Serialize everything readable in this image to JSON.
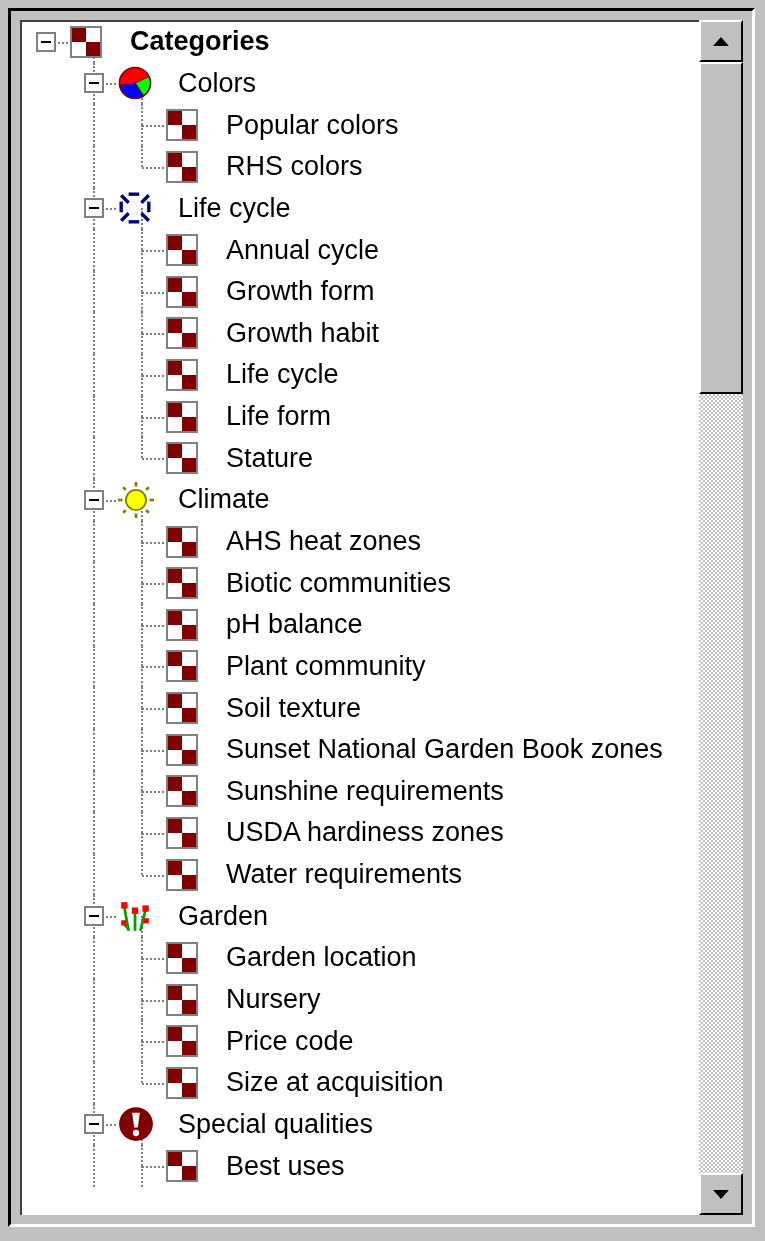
{
  "tree": {
    "nodes": [
      {
        "label": "Categories",
        "kind": "checker",
        "expanded": true,
        "children": [
          {
            "label": "Colors",
            "kind": "pie",
            "expanded": true,
            "children": [
              {
                "label": "Popular colors",
                "kind": "checker"
              },
              {
                "label": "RHS colors",
                "kind": "checker"
              }
            ]
          },
          {
            "label": "Life cycle",
            "kind": "cycle",
            "expanded": true,
            "children": [
              {
                "label": "Annual cycle",
                "kind": "checker"
              },
              {
                "label": "Growth form",
                "kind": "checker"
              },
              {
                "label": "Growth habit",
                "kind": "checker"
              },
              {
                "label": "Life cycle",
                "kind": "checker"
              },
              {
                "label": "Life form",
                "kind": "checker"
              },
              {
                "label": "Stature",
                "kind": "checker"
              }
            ]
          },
          {
            "label": "Climate",
            "kind": "sun",
            "expanded": true,
            "children": [
              {
                "label": "AHS heat zones",
                "kind": "checker"
              },
              {
                "label": "Biotic communities",
                "kind": "checker"
              },
              {
                "label": "pH balance",
                "kind": "checker"
              },
              {
                "label": "Plant community",
                "kind": "checker"
              },
              {
                "label": "Soil texture",
                "kind": "checker"
              },
              {
                "label": "Sunset National Garden Book zones",
                "kind": "checker"
              },
              {
                "label": "Sunshine requirements",
                "kind": "checker"
              },
              {
                "label": "USDA hardiness zones",
                "kind": "checker"
              },
              {
                "label": "Water requirements",
                "kind": "checker"
              }
            ]
          },
          {
            "label": "Garden",
            "kind": "flowers",
            "expanded": true,
            "children": [
              {
                "label": "Garden location",
                "kind": "checker"
              },
              {
                "label": "Nursery",
                "kind": "checker"
              },
              {
                "label": "Price code",
                "kind": "checker"
              },
              {
                "label": "Size at acquisition",
                "kind": "checker"
              }
            ]
          },
          {
            "label": "Special qualities",
            "kind": "alert",
            "expanded": true,
            "children": [
              {
                "label": "Best uses",
                "kind": "checker"
              }
            ]
          }
        ]
      }
    ]
  }
}
